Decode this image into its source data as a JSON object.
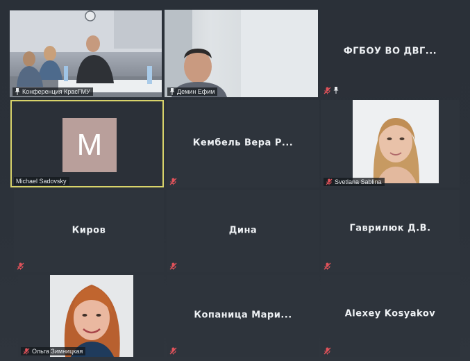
{
  "tiles": {
    "t1": {
      "label": "Конференция КрасГМУ"
    },
    "t2": {
      "label": "Демин Ефим"
    },
    "t3": {
      "name": "ФГБОУ ВО ДВГ..."
    },
    "t4": {
      "label": "Michael Sadovsky",
      "avatar_letter": "M"
    },
    "t5": {
      "name": "Кембель Вера Р..."
    },
    "t6": {
      "label": "Svetlana Sablina"
    },
    "t7": {
      "name": "Киров"
    },
    "t8": {
      "name": "Дина"
    },
    "t9": {
      "name": "Гаврилюк Д.В."
    },
    "t10": {
      "label": "Ольга Зимницкая"
    },
    "t11": {
      "name": "Копаница Мари..."
    },
    "t12": {
      "name": "Alexey Kosyakov"
    }
  },
  "colors": {
    "background": "#262b33",
    "tile": "#2e343c",
    "active_speaker_border": "#d8d36a",
    "muted_icon": "#e0525a",
    "avatar_bg": "#b99f9b"
  },
  "icons": {
    "muted": "muted-mic-icon",
    "pinned": "pin-icon"
  }
}
